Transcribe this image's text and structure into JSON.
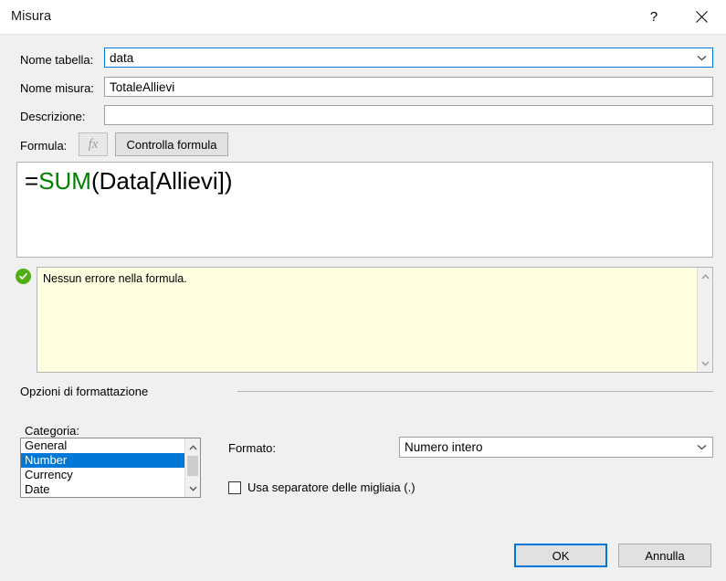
{
  "window": {
    "title": "Misura",
    "help_button": "?",
    "close_button": "×"
  },
  "fields": {
    "table_name": {
      "label": "Nome tabella:",
      "value": "data",
      "placeholder": ""
    },
    "measure_name": {
      "label": "Nome misura:",
      "value": "TotaleAllievi",
      "placeholder": ""
    },
    "description": {
      "label": "Descrizione:",
      "value": "",
      "placeholder": ""
    },
    "formula": {
      "label": "Formula:",
      "fx_button": "fx",
      "check_formula_button": "Controlla formula",
      "tokens": [
        {
          "text": "=",
          "kind": "plain"
        },
        {
          "text": "SUM",
          "kind": "fn"
        },
        {
          "text": "(Data[Allievi])",
          "kind": "plain"
        }
      ],
      "full_text": "=SUM(Data[Allievi])"
    }
  },
  "validation": {
    "status_icon": "check-circle-icon",
    "message": "Nessun errore nella formula."
  },
  "formatting": {
    "group_label": "Opzioni di formattazione",
    "category_label": "Categoria:",
    "categories": [
      {
        "label": "General",
        "selected": false
      },
      {
        "label": "Number",
        "selected": true
      },
      {
        "label": "Currency",
        "selected": false
      },
      {
        "label": "Date",
        "selected": false
      }
    ],
    "format_label": "Formato:",
    "format_value": "Numero intero",
    "thousands_separator": {
      "label": "Usa separatore delle migliaia (.)",
      "checked": false
    }
  },
  "footer": {
    "ok_button": "OK",
    "cancel_button": "Annulla"
  },
  "colors": {
    "dialog_background": "#f0f0f0",
    "accent_blue": "#0078d7",
    "function_green": "#008000",
    "tooltip_yellow": "#ffffe1",
    "success_green": "#4eae12"
  }
}
